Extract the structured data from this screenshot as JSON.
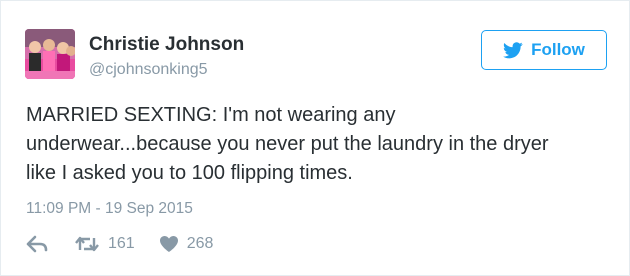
{
  "tweet": {
    "user": {
      "name": "Christie Johnson",
      "handle": "@cjohnsonking5"
    },
    "follow_button": {
      "label": "Follow",
      "icon": "twitter-bird-icon"
    },
    "text_lines": [
      "MARRIED SEXTING: I'm not wearing any",
      "underwear...because you never put the laundry in the dryer",
      "like I asked you to 100 flipping times."
    ],
    "timestamp": "11:09 PM - 19 Sep 2015",
    "actions": {
      "reply_icon": "reply-icon",
      "retweet_icon": "retweet-icon",
      "retweet_count": "161",
      "like_icon": "heart-icon",
      "like_count": "268"
    }
  },
  "colors": {
    "accent": "#1da1f2",
    "text": "#292f33",
    "muted": "#8899a6"
  }
}
